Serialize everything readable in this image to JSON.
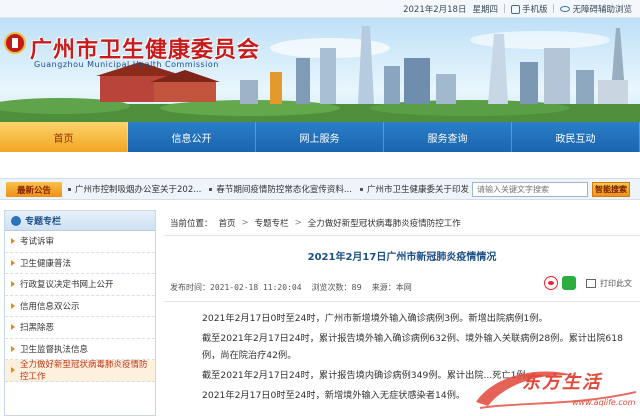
{
  "topbar": {
    "date": "2021年2月18日",
    "weekday": "星期四",
    "mobile": "手机版",
    "accessible": "无障碍辅助浏览"
  },
  "banner": {
    "title": "广州市卫生健康委员会",
    "subtitle": "Guangzhou Municipal Health Commission"
  },
  "nav": {
    "items": [
      {
        "label": "首页",
        "active": true
      },
      {
        "label": "信息公开",
        "active": false
      },
      {
        "label": "网上服务",
        "active": false
      },
      {
        "label": "服务查询",
        "active": false
      },
      {
        "label": "政民互动",
        "active": false
      }
    ]
  },
  "notice": {
    "tag": "最新公告",
    "items": [
      "广州市控制吸烟办公室关于202...",
      "春节期间疫情防控常态化宣传资料...",
      "广州市卫生健康委关于印发《关于..."
    ],
    "search_placeholder": "请输入关键文字搜索",
    "search_button": "智能搜索"
  },
  "sidebar": {
    "title": "专题专栏",
    "items": [
      {
        "label": "考试诉审",
        "active": false
      },
      {
        "label": "卫生健康普法",
        "active": false
      },
      {
        "label": "行政复议决定书网上公开",
        "active": false
      },
      {
        "label": "信用信息双公示",
        "active": false
      },
      {
        "label": "扫黑除恶",
        "active": false
      },
      {
        "label": "卫生监督执法信息",
        "active": false
      },
      {
        "label": "全力做好新型冠状病毒肺炎疫情防控工作",
        "active": true
      }
    ]
  },
  "main": {
    "breadcrumb": {
      "prefix": "当前位置：",
      "items": [
        "首页",
        "专题专栏",
        "全力做好新型冠状病毒肺炎疫情防控工作"
      ]
    },
    "article_title": "2021年2月17日广州市新冠肺炎疫情情况",
    "meta": {
      "published_label": "发布时间：",
      "published": "2021-02-18 11:20:04",
      "views_label": "浏览次数：",
      "views": "89",
      "source_label": "来源：",
      "source": "本网"
    },
    "print_label": "打印此文",
    "paragraphs": [
      "2021年2月17日0时至24时，广州市新增境外输入确诊病例3例。新增出院病例1例。",
      "截至2021年2月17日24时，累计报告境外输入确诊病例632例、境外输入关联病例28例。累计出院618例，尚在院治疗42例。",
      "截至2021年2月17日24时，累计报告境内确诊病例349例。累计出院...死亡1例。",
      "2021年2月17日0时至24时，新增境外输入无症状感染者14例。"
    ]
  },
  "watermark": {
    "text": "东方生活",
    "url": "www.aqlife.com"
  },
  "colors": {
    "nav_blue": "#1b64ae",
    "active_orange": "#f3a622",
    "title_red": "#c81c1c",
    "link_blue": "#1c4f8a"
  }
}
